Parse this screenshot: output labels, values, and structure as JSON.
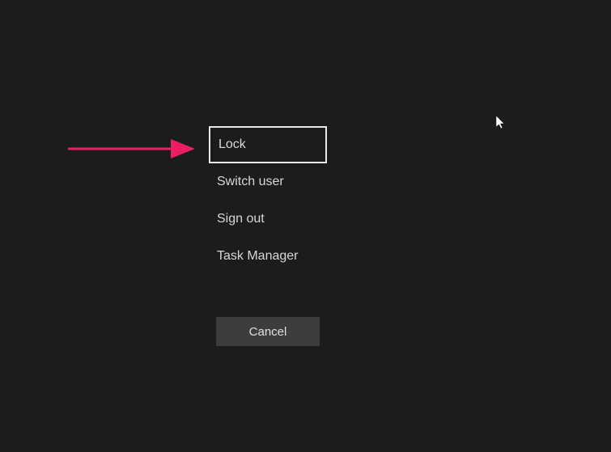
{
  "security_menu": {
    "items": [
      {
        "label": "Lock",
        "selected": true
      },
      {
        "label": "Switch user",
        "selected": false
      },
      {
        "label": "Sign out",
        "selected": false
      },
      {
        "label": "Task Manager",
        "selected": false
      }
    ],
    "cancel_label": "Cancel"
  },
  "annotation": {
    "arrow_color": "#e91e63"
  }
}
